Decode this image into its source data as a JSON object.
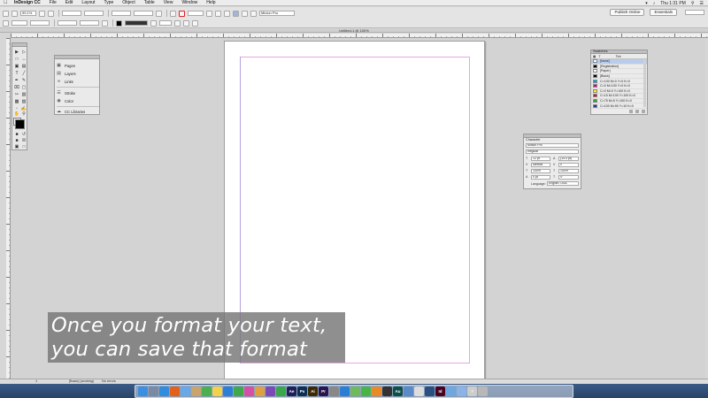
{
  "menubar": {
    "app_name": "InDesign CC",
    "items": [
      "File",
      "Edit",
      "Layout",
      "Type",
      "Object",
      "Table",
      "View",
      "Window",
      "Help"
    ],
    "clock": "Thu 1:31 PM"
  },
  "controlbar": {
    "zoom": "99.1%",
    "font_family": "Minion Pro",
    "publish_label": "Publish Online",
    "workspace_label": "Essentials"
  },
  "document": {
    "tab_title": "Untitled-1 @ 100%"
  },
  "pages_panel": {
    "items": [
      {
        "label": "Pages",
        "icon": "pages-icon"
      },
      {
        "label": "Layers",
        "icon": "layers-icon"
      },
      {
        "label": "Links",
        "icon": "links-icon"
      },
      {
        "label": "Stroke",
        "icon": "stroke-icon"
      },
      {
        "label": "Color",
        "icon": "color-icon"
      },
      {
        "label": "CC Libraries",
        "icon": "cc-libraries-icon"
      }
    ]
  },
  "swatches_panel": {
    "title": "Swatches",
    "tint_label": "Tint",
    "rows": [
      {
        "name": "[None]",
        "color": "#ffffff"
      },
      {
        "name": "[Registration]",
        "color": "#000000"
      },
      {
        "name": "[Paper]",
        "color": "#ffffff"
      },
      {
        "name": "[Black]",
        "color": "#000000"
      },
      {
        "name": "C=100 M=0 Y=0 K=0",
        "color": "#00a0e8"
      },
      {
        "name": "C=0 M=100 Y=0 K=0",
        "color": "#e4007f"
      },
      {
        "name": "C=0 M=0 Y=100 K=0",
        "color": "#fff100"
      },
      {
        "name": "C=15 M=100 Y=100 K=0",
        "color": "#c8161d"
      },
      {
        "name": "C=75 M=5 Y=100 K=0",
        "color": "#35a03a"
      },
      {
        "name": "C=100 M=90 Y=10 K=0",
        "color": "#1d3a8a"
      }
    ]
  },
  "character_panel": {
    "title": "Character",
    "font_family": "Minion Pro",
    "font_style": "Regular",
    "font_size": "12 pt",
    "leading": "(14.4 pt)",
    "kerning": "Metrics",
    "tracking": "0",
    "vertical_scale": "100%",
    "horizontal_scale": "100%",
    "baseline_shift": "0 pt",
    "skew": "0°",
    "language_label": "Language:",
    "language": "English: USA"
  },
  "caption": {
    "line1": "Once you format your text,",
    "line2": "you can save that format"
  },
  "statusbar": {
    "page_number": "1",
    "preflight": "[Basic] (working)",
    "errors": "No errors"
  },
  "dock_apps": [
    {
      "name": "finder",
      "color": "#3d8fe0",
      "label": ""
    },
    {
      "name": "launchpad",
      "color": "#7a8aa0",
      "label": ""
    },
    {
      "name": "safari",
      "color": "#2f8de0",
      "label": ""
    },
    {
      "name": "firefox",
      "color": "#e2621b",
      "label": ""
    },
    {
      "name": "mail",
      "color": "#6aa7e8",
      "label": ""
    },
    {
      "name": "contacts",
      "color": "#c9a46d",
      "label": ""
    },
    {
      "name": "chrome",
      "color": "#4caf50",
      "label": ""
    },
    {
      "name": "notes",
      "color": "#f2d24b",
      "label": ""
    },
    {
      "name": "keynote",
      "color": "#2c7fd4",
      "label": ""
    },
    {
      "name": "numbers",
      "color": "#3ea94a",
      "label": ""
    },
    {
      "name": "itunes",
      "color": "#d74ea5",
      "label": ""
    },
    {
      "name": "photos",
      "color": "#e0a040",
      "label": ""
    },
    {
      "name": "imovie",
      "color": "#7b4ab8",
      "label": ""
    },
    {
      "name": "facetime",
      "color": "#3aa84a",
      "label": ""
    },
    {
      "name": "after-effects",
      "color": "#1f1f5a",
      "label": "Ae"
    },
    {
      "name": "photoshop",
      "color": "#0b2f55",
      "label": "Ps"
    },
    {
      "name": "illustrator",
      "color": "#3c2a05",
      "label": "Ai"
    },
    {
      "name": "premiere",
      "color": "#2a1450",
      "label": "Pr"
    },
    {
      "name": "system-prefs",
      "color": "#888888",
      "label": ""
    },
    {
      "name": "app-store",
      "color": "#2a7fd4",
      "label": ""
    },
    {
      "name": "maps",
      "color": "#6fba5a",
      "label": ""
    },
    {
      "name": "messages",
      "color": "#49b549",
      "label": ""
    },
    {
      "name": "ibooks",
      "color": "#e88a2a",
      "label": ""
    },
    {
      "name": "terminal",
      "color": "#333333",
      "label": ""
    },
    {
      "name": "audition",
      "color": "#0f4f4a",
      "label": "Au"
    },
    {
      "name": "preview",
      "color": "#5a8ac8",
      "label": ""
    },
    {
      "name": "textedit",
      "color": "#dddddd",
      "label": ""
    },
    {
      "name": "quicktime",
      "color": "#2a4f80",
      "label": ""
    },
    {
      "name": "indesign",
      "color": "#49021f",
      "label": "Id"
    },
    {
      "name": "folder",
      "color": "#6fa8e0",
      "label": ""
    },
    {
      "name": "documents",
      "color": "#8ab4e8",
      "label": ""
    },
    {
      "name": "help",
      "color": "#cccccc",
      "label": "?"
    },
    {
      "name": "trash",
      "color": "#b8b8b8",
      "label": ""
    }
  ]
}
